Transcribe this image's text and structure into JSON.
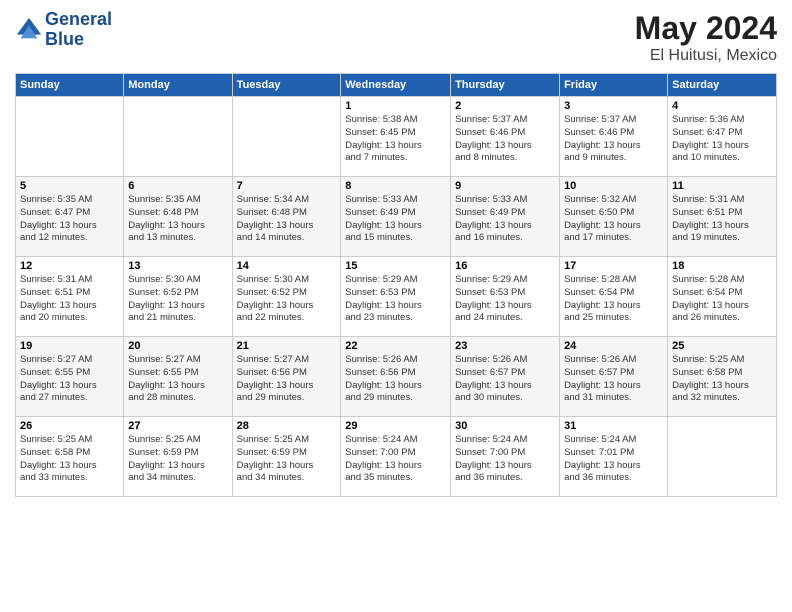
{
  "header": {
    "logo_line1": "General",
    "logo_line2": "Blue",
    "title": "May 2024",
    "subtitle": "El Huitusi, Mexico"
  },
  "weekdays": [
    "Sunday",
    "Monday",
    "Tuesday",
    "Wednesday",
    "Thursday",
    "Friday",
    "Saturday"
  ],
  "rows": [
    [
      {
        "day": "",
        "info": ""
      },
      {
        "day": "",
        "info": ""
      },
      {
        "day": "",
        "info": ""
      },
      {
        "day": "1",
        "info": "Sunrise: 5:38 AM\nSunset: 6:45 PM\nDaylight: 13 hours\nand 7 minutes."
      },
      {
        "day": "2",
        "info": "Sunrise: 5:37 AM\nSunset: 6:46 PM\nDaylight: 13 hours\nand 8 minutes."
      },
      {
        "day": "3",
        "info": "Sunrise: 5:37 AM\nSunset: 6:46 PM\nDaylight: 13 hours\nand 9 minutes."
      },
      {
        "day": "4",
        "info": "Sunrise: 5:36 AM\nSunset: 6:47 PM\nDaylight: 13 hours\nand 10 minutes."
      }
    ],
    [
      {
        "day": "5",
        "info": "Sunrise: 5:35 AM\nSunset: 6:47 PM\nDaylight: 13 hours\nand 12 minutes."
      },
      {
        "day": "6",
        "info": "Sunrise: 5:35 AM\nSunset: 6:48 PM\nDaylight: 13 hours\nand 13 minutes."
      },
      {
        "day": "7",
        "info": "Sunrise: 5:34 AM\nSunset: 6:48 PM\nDaylight: 13 hours\nand 14 minutes."
      },
      {
        "day": "8",
        "info": "Sunrise: 5:33 AM\nSunset: 6:49 PM\nDaylight: 13 hours\nand 15 minutes."
      },
      {
        "day": "9",
        "info": "Sunrise: 5:33 AM\nSunset: 6:49 PM\nDaylight: 13 hours\nand 16 minutes."
      },
      {
        "day": "10",
        "info": "Sunrise: 5:32 AM\nSunset: 6:50 PM\nDaylight: 13 hours\nand 17 minutes."
      },
      {
        "day": "11",
        "info": "Sunrise: 5:31 AM\nSunset: 6:51 PM\nDaylight: 13 hours\nand 19 minutes."
      }
    ],
    [
      {
        "day": "12",
        "info": "Sunrise: 5:31 AM\nSunset: 6:51 PM\nDaylight: 13 hours\nand 20 minutes."
      },
      {
        "day": "13",
        "info": "Sunrise: 5:30 AM\nSunset: 6:52 PM\nDaylight: 13 hours\nand 21 minutes."
      },
      {
        "day": "14",
        "info": "Sunrise: 5:30 AM\nSunset: 6:52 PM\nDaylight: 13 hours\nand 22 minutes."
      },
      {
        "day": "15",
        "info": "Sunrise: 5:29 AM\nSunset: 6:53 PM\nDaylight: 13 hours\nand 23 minutes."
      },
      {
        "day": "16",
        "info": "Sunrise: 5:29 AM\nSunset: 6:53 PM\nDaylight: 13 hours\nand 24 minutes."
      },
      {
        "day": "17",
        "info": "Sunrise: 5:28 AM\nSunset: 6:54 PM\nDaylight: 13 hours\nand 25 minutes."
      },
      {
        "day": "18",
        "info": "Sunrise: 5:28 AM\nSunset: 6:54 PM\nDaylight: 13 hours\nand 26 minutes."
      }
    ],
    [
      {
        "day": "19",
        "info": "Sunrise: 5:27 AM\nSunset: 6:55 PM\nDaylight: 13 hours\nand 27 minutes."
      },
      {
        "day": "20",
        "info": "Sunrise: 5:27 AM\nSunset: 6:55 PM\nDaylight: 13 hours\nand 28 minutes."
      },
      {
        "day": "21",
        "info": "Sunrise: 5:27 AM\nSunset: 6:56 PM\nDaylight: 13 hours\nand 29 minutes."
      },
      {
        "day": "22",
        "info": "Sunrise: 5:26 AM\nSunset: 6:56 PM\nDaylight: 13 hours\nand 29 minutes."
      },
      {
        "day": "23",
        "info": "Sunrise: 5:26 AM\nSunset: 6:57 PM\nDaylight: 13 hours\nand 30 minutes."
      },
      {
        "day": "24",
        "info": "Sunrise: 5:26 AM\nSunset: 6:57 PM\nDaylight: 13 hours\nand 31 minutes."
      },
      {
        "day": "25",
        "info": "Sunrise: 5:25 AM\nSunset: 6:58 PM\nDaylight: 13 hours\nand 32 minutes."
      }
    ],
    [
      {
        "day": "26",
        "info": "Sunrise: 5:25 AM\nSunset: 6:58 PM\nDaylight: 13 hours\nand 33 minutes."
      },
      {
        "day": "27",
        "info": "Sunrise: 5:25 AM\nSunset: 6:59 PM\nDaylight: 13 hours\nand 34 minutes."
      },
      {
        "day": "28",
        "info": "Sunrise: 5:25 AM\nSunset: 6:59 PM\nDaylight: 13 hours\nand 34 minutes."
      },
      {
        "day": "29",
        "info": "Sunrise: 5:24 AM\nSunset: 7:00 PM\nDaylight: 13 hours\nand 35 minutes."
      },
      {
        "day": "30",
        "info": "Sunrise: 5:24 AM\nSunset: 7:00 PM\nDaylight: 13 hours\nand 36 minutes."
      },
      {
        "day": "31",
        "info": "Sunrise: 5:24 AM\nSunset: 7:01 PM\nDaylight: 13 hours\nand 36 minutes."
      },
      {
        "day": "",
        "info": ""
      }
    ]
  ]
}
